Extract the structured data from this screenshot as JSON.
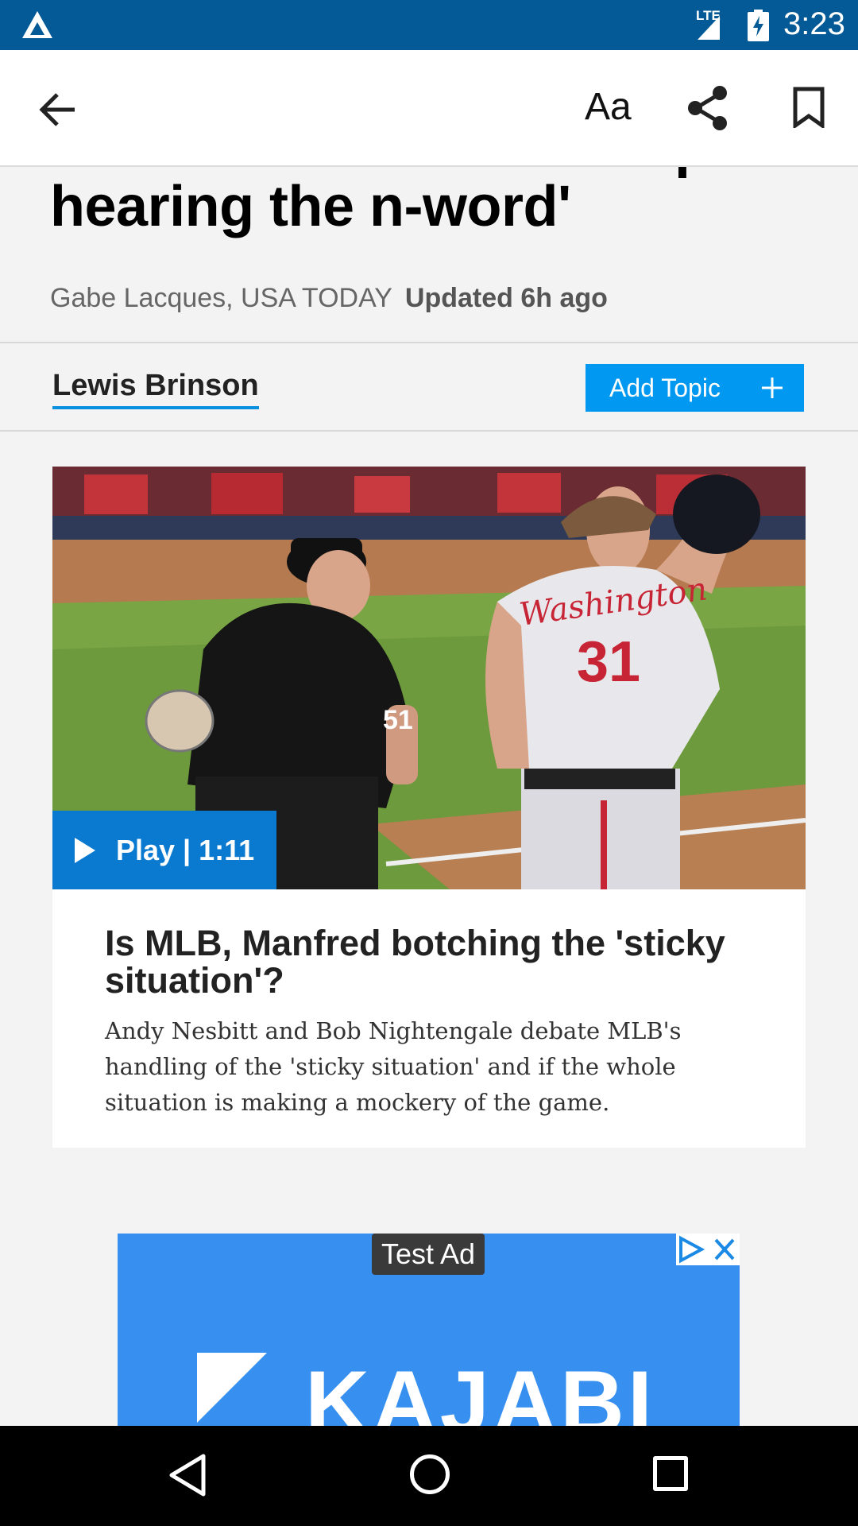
{
  "status_bar": {
    "network": "LTE",
    "time": "3:23"
  },
  "toolbar": {
    "text_size_label": "Aa"
  },
  "article": {
    "headline_line1": "can't unhear slur: 'I keep",
    "headline_line2": "hearing the n-word'",
    "author": "Gabe Lacques, USA TODAY",
    "updated": "Updated 6h ago"
  },
  "topic": {
    "name": "Lewis Brinson",
    "add_label": "Add Topic"
  },
  "video": {
    "play_label": "Play | 1:11",
    "title": "Is MLB, Manfred botching the 'sticky situation'?",
    "description": "Andy Nesbitt and Bob Nightengale debate MLB's handling of the 'sticky situation' and if the whole situation is making a mockery of the game.",
    "jersey_text": "Washington",
    "jersey_number": "31",
    "umpire_number": "51"
  },
  "ad": {
    "label": "Test Ad",
    "brand": "KAJABI"
  },
  "colors": {
    "status_bar": "#035a96",
    "accent": "#0098f0",
    "play": "#0a7ad0",
    "ad_bg": "#3790ef"
  }
}
